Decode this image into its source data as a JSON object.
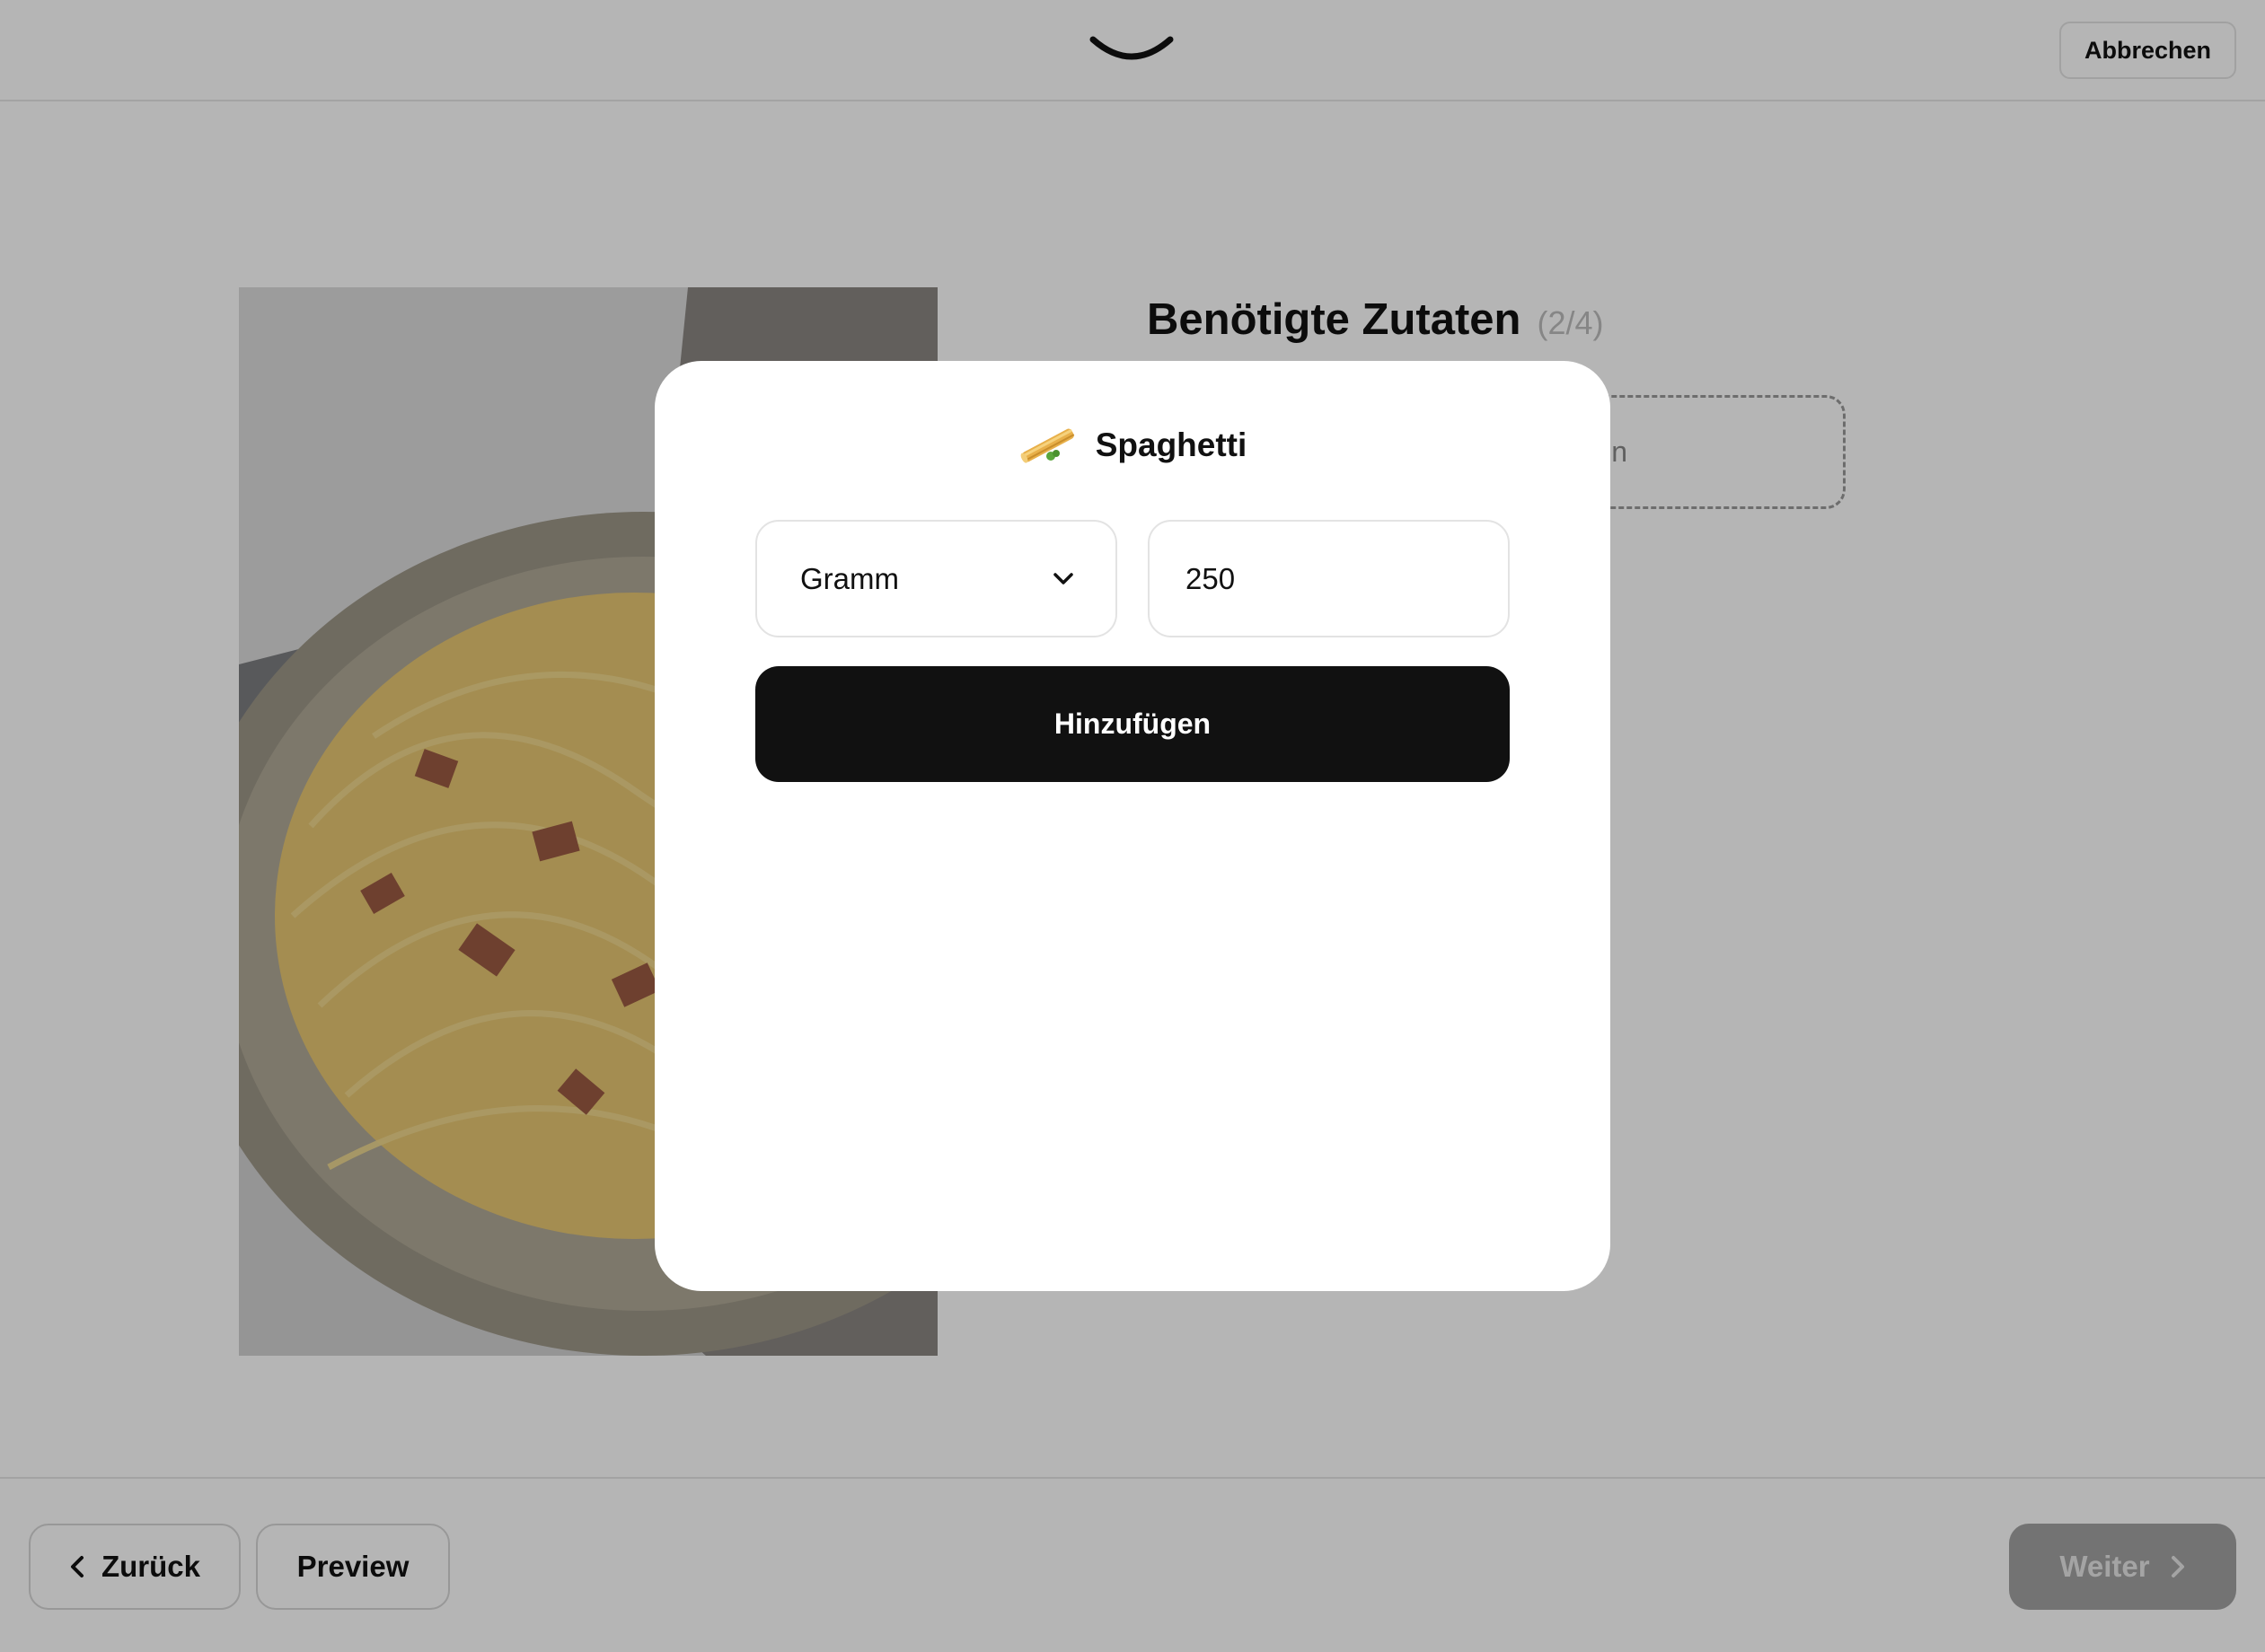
{
  "header": {
    "cancel_label": "Abbrechen",
    "logo_icon": "smile-logo-icon"
  },
  "main": {
    "title": "Benötigte Zutaten",
    "step_counter": "(2/4)",
    "add_ingredient_partial": "n",
    "photo_icon": "pasta-carbonara-photo"
  },
  "footer": {
    "back_label": "Zurück",
    "preview_label": "Preview",
    "next_label": "Weiter"
  },
  "modal": {
    "ingredient_icon": "spaghetti-icon",
    "ingredient_name": "Spaghetti",
    "unit_selected": "Gramm",
    "quantity_value": "250",
    "add_label": "Hinzufügen"
  },
  "colors": {
    "primary_button": "#111111",
    "overlay": "rgba(0,0,0,0.29)",
    "next_button_disabled": "#a3a3a3"
  }
}
